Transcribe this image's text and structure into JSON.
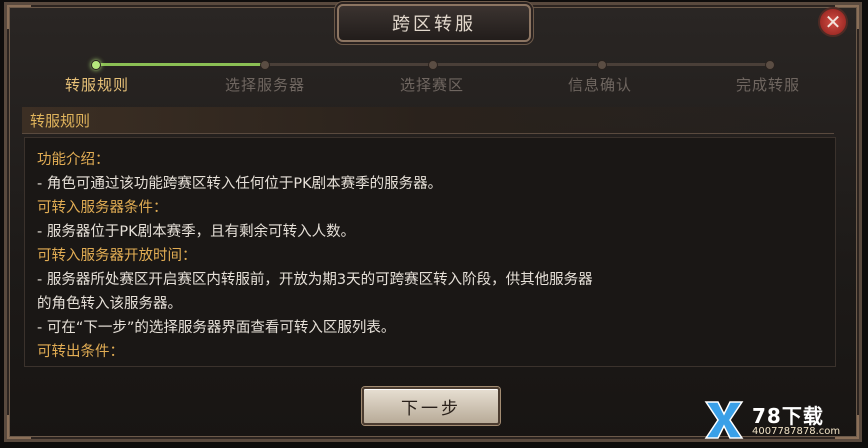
{
  "window": {
    "title": "跨区转服",
    "close_glyph": "✕"
  },
  "steps": [
    {
      "label": "转服规则",
      "state": "active"
    },
    {
      "label": "选择服务器",
      "state": "pending"
    },
    {
      "label": "选择赛区",
      "state": "pending"
    },
    {
      "label": "信息确认",
      "state": "pending"
    },
    {
      "label": "完成转服",
      "state": "pending"
    }
  ],
  "progress": {
    "completed_steps": 1,
    "total_steps": 5
  },
  "section": {
    "title": "转服规则"
  },
  "rules": [
    {
      "text": "功能介绍：",
      "kind": "heading"
    },
    {
      "text": "- 角色可通过该功能跨赛区转入任何位于PK剧本赛季的服务器。",
      "kind": "body"
    },
    {
      "text": "可转入服务器条件：",
      "kind": "heading"
    },
    {
      "text": "- 服务器位于PK剧本赛季，且有剩余可转入人数。",
      "kind": "body"
    },
    {
      "text": "可转入服务器开放时间：",
      "kind": "heading"
    },
    {
      "text": "- 服务器所处赛区开启赛区内转服前，开放为期3天的可跨赛区转入阶段，供其他服务器",
      "kind": "body"
    },
    {
      "text": "的角色转入该服务器。",
      "kind": "body"
    },
    {
      "text": "- 可在“下一步”的选择服务器界面查看可转入区服列表。",
      "kind": "body"
    },
    {
      "text": "可转出条件：",
      "kind": "heading"
    }
  ],
  "buttons": {
    "next": "下一步"
  },
  "watermark": {
    "brand": "78下载",
    "url": "4007787878.com",
    "icon": "x-logo-icon"
  },
  "colors": {
    "accent_gold": "#e2ad54",
    "active_step": "#e7c178",
    "progress_green": "#8bbf54",
    "close_red": "#c0392b"
  }
}
